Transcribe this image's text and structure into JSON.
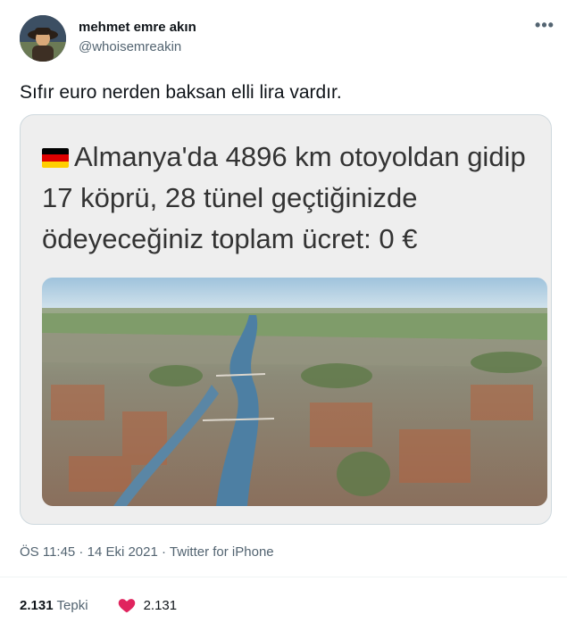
{
  "author": {
    "display_name": "mehmet emre akın",
    "handle": "@whoisemreakin",
    "avatar_icon": "profile-avatar"
  },
  "menu_icon": "more-horizontal-icon",
  "tweet_text": "Sıfır euro nerden baksan elli lira vardır.",
  "card": {
    "flag_icon": "germany-flag-icon",
    "flag_colors": [
      "#000000",
      "#dd0000",
      "#ffce00"
    ],
    "text": "Almanya'da 4896 km otoyoldan gidip 17 köprü, 28 tünel geçtiğinizde ödeyeceğiniz toplam ücret: 0 €",
    "image_description_icon": "aerial-city-photo"
  },
  "meta": {
    "time": "ÖS 11:45",
    "date": "14 Eki 2021",
    "source": "Twitter for iPhone",
    "separator": " · "
  },
  "stats": {
    "reactions_count": "2.131",
    "reactions_label": "Tepki",
    "likes_count": "2.131",
    "like_icon": "heart-icon",
    "like_color": "#e0245e"
  },
  "colors": {
    "text_primary": "#0f1419",
    "text_secondary": "#536471",
    "card_bg": "#eeeeee",
    "border": "#cfd9de"
  }
}
